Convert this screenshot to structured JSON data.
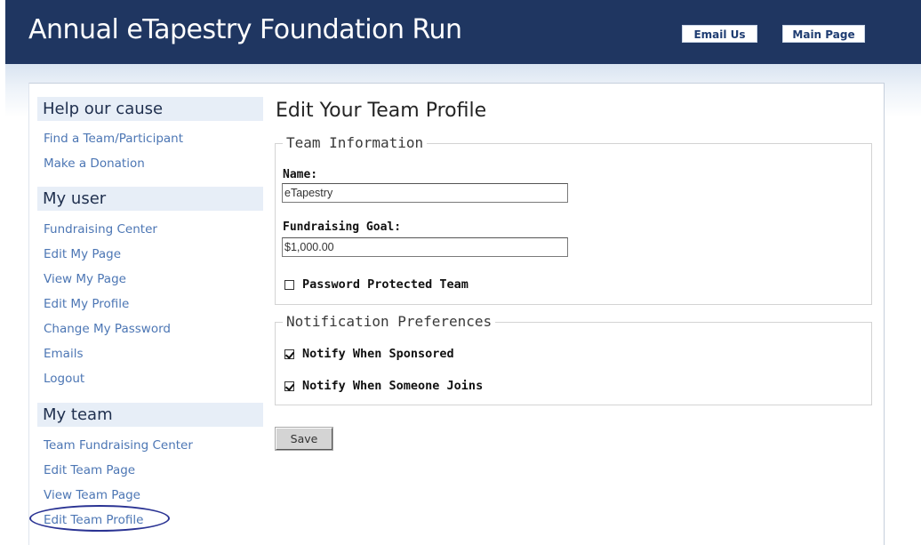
{
  "header": {
    "title": "Annual eTapestry Foundation Run",
    "buttons": {
      "email": "Email Us",
      "main": "Main Page"
    }
  },
  "sidebar": {
    "sections": [
      {
        "title": "Help our cause",
        "links": [
          "Find a Team/Participant",
          "Make a Donation"
        ]
      },
      {
        "title": "My user",
        "links": [
          "Fundraising Center",
          "Edit My Page",
          "View My Page",
          "Edit My Profile",
          "Change My Password",
          "Emails",
          "Logout"
        ]
      },
      {
        "title": "My team",
        "links": [
          "Team Fundraising Center",
          "Edit Team Page",
          "View Team Page",
          "Edit Team Profile"
        ]
      }
    ],
    "highlighted_link": "Edit Team Profile",
    "highlight_color": "#2a3393"
  },
  "main": {
    "title": "Edit Your Team Profile",
    "team_info": {
      "legend": "Team Information",
      "name_label": "Name:",
      "name_value": "eTapestry",
      "goal_label": "Fundraising Goal:",
      "goal_value": "$1,000.00",
      "password_label": "Password Protected Team",
      "password_checked": false
    },
    "notifications": {
      "legend": "Notification Preferences",
      "sponsored_label": "Notify When Sponsored",
      "sponsored_checked": true,
      "joins_label": "Notify When Someone Joins",
      "joins_checked": true
    },
    "save_label": "Save"
  },
  "colors": {
    "header_bg": "#1f3661",
    "link": "#4c76b4",
    "section_bg": "#e7eef7"
  }
}
